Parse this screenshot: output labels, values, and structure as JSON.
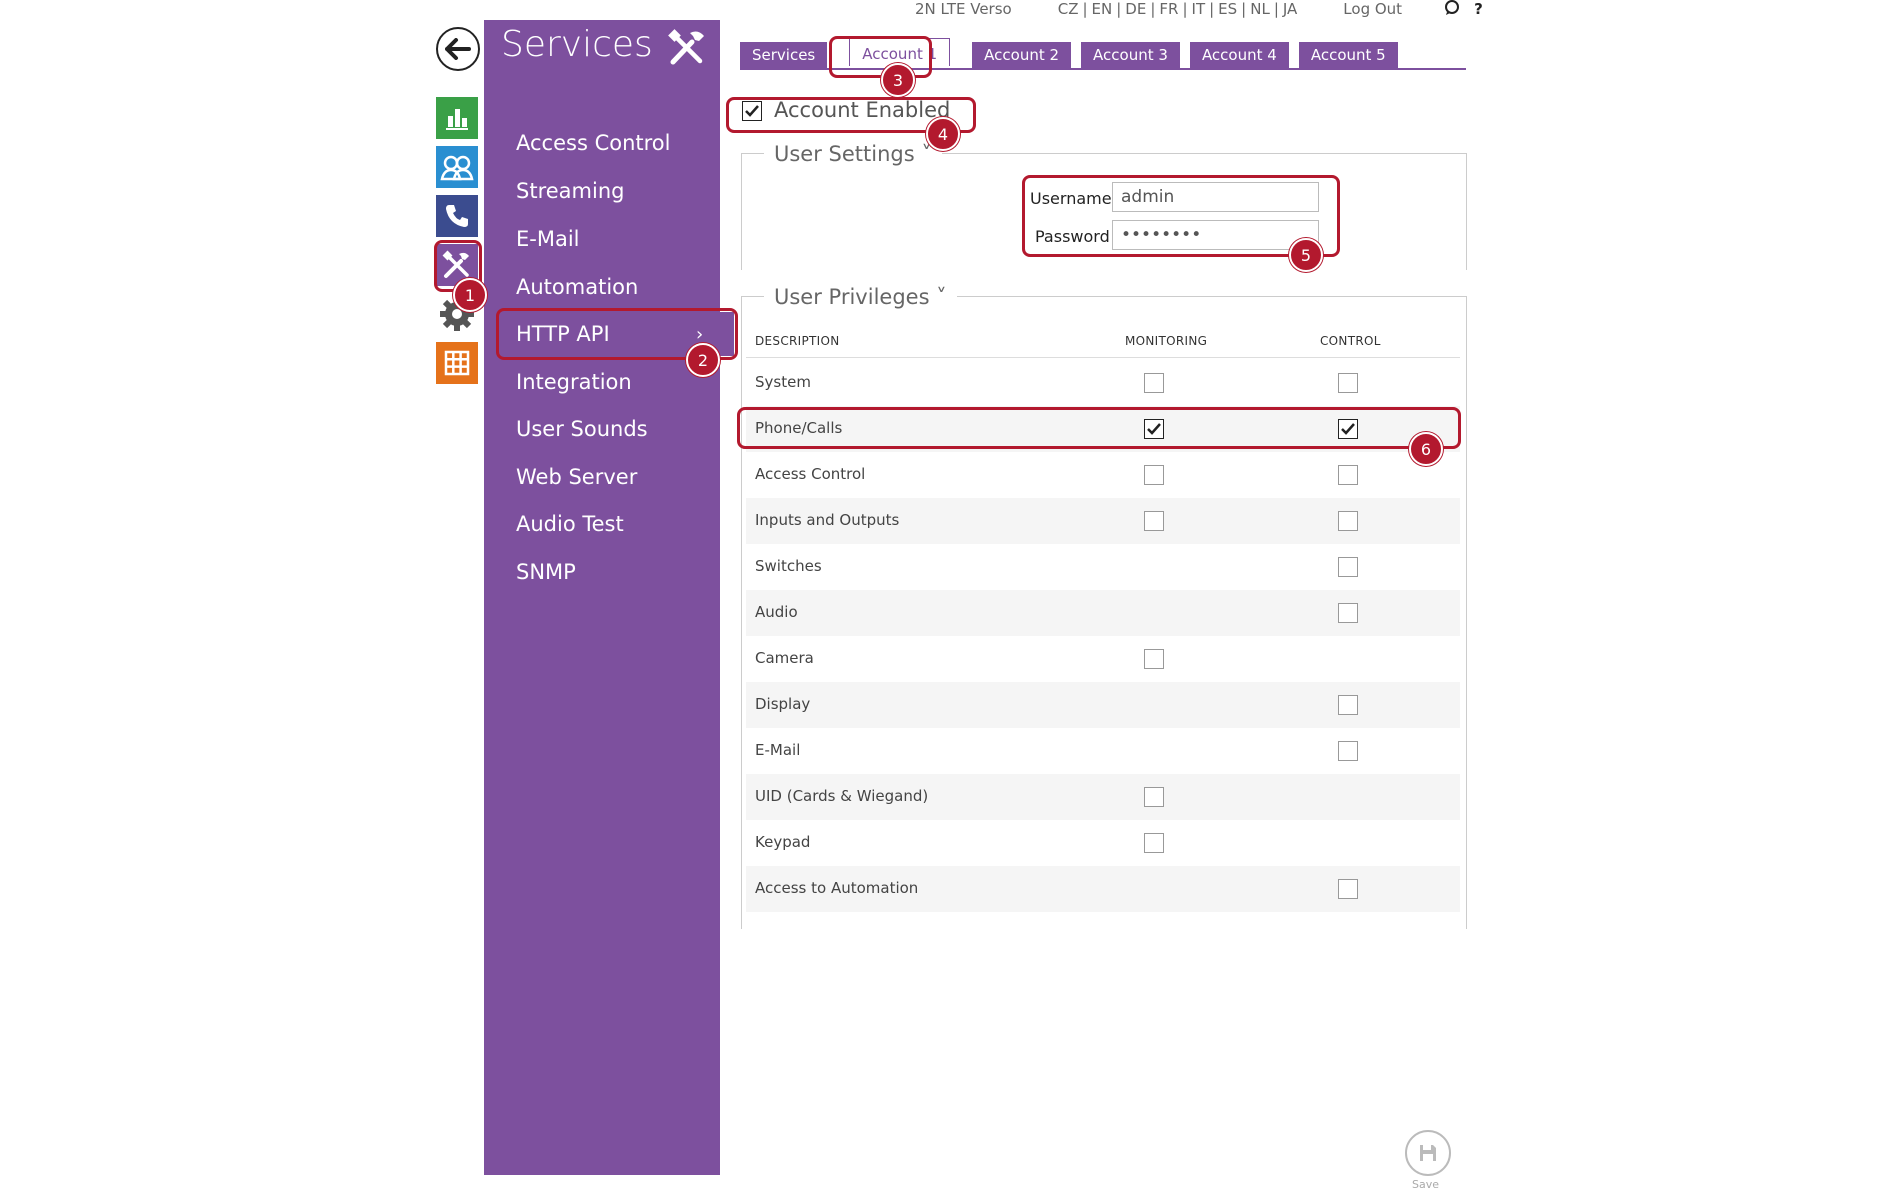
{
  "topbar": {
    "device": "2N LTE Verso",
    "languages": [
      "CZ",
      "EN",
      "DE",
      "FR",
      "IT",
      "ES",
      "NL",
      "JA"
    ],
    "logout": "Log Out",
    "help": "?"
  },
  "rail": {
    "icons": [
      "chart-icon",
      "users-icon",
      "phone-icon",
      "tools-icon",
      "gear-icon",
      "grid-icon"
    ],
    "colors": [
      "#3aa047",
      "#2a8fd1",
      "#3b4c8f",
      "#7d509e",
      "#555555",
      "#e5721a"
    ]
  },
  "sidebar": {
    "title": "Services",
    "items": [
      {
        "label": "Access Control"
      },
      {
        "label": "Streaming"
      },
      {
        "label": "E-Mail"
      },
      {
        "label": "Automation"
      },
      {
        "label": "HTTP API",
        "active": true
      },
      {
        "label": "Integration"
      },
      {
        "label": "User Sounds"
      },
      {
        "label": "Web Server"
      },
      {
        "label": "Audio Test"
      },
      {
        "label": "SNMP"
      }
    ]
  },
  "tabs": [
    "Services",
    "Account 1",
    "Account 2",
    "Account 3",
    "Account 4",
    "Account 5"
  ],
  "active_tab": "Account 1",
  "account": {
    "enabled_label": "Account Enabled",
    "enabled": true
  },
  "user_settings": {
    "title": "User Settings ˅",
    "username_label": "Username",
    "username_value": "admin",
    "password_label": "Password",
    "password_value": "••••••••"
  },
  "privileges": {
    "title": "User Privileges ˅",
    "headers": {
      "description": "DESCRIPTION",
      "monitoring": "MONITORING",
      "control": "CONTROL"
    },
    "rows": [
      {
        "label": "System",
        "monitoring": false,
        "control": false
      },
      {
        "label": "Phone/Calls",
        "monitoring": true,
        "control": true
      },
      {
        "label": "Access Control",
        "monitoring": false,
        "control": false
      },
      {
        "label": "Inputs and Outputs",
        "monitoring": false,
        "control": false
      },
      {
        "label": "Switches",
        "monitoring": null,
        "control": false
      },
      {
        "label": "Audio",
        "monitoring": null,
        "control": false
      },
      {
        "label": "Camera",
        "monitoring": false,
        "control": null
      },
      {
        "label": "Display",
        "monitoring": null,
        "control": false
      },
      {
        "label": "E-Mail",
        "monitoring": null,
        "control": false
      },
      {
        "label": "UID (Cards & Wiegand)",
        "monitoring": false,
        "control": null
      },
      {
        "label": "Keypad",
        "monitoring": false,
        "control": null
      },
      {
        "label": "Access to Automation",
        "monitoring": null,
        "control": false
      }
    ]
  },
  "annotations": [
    "1",
    "2",
    "3",
    "4",
    "5",
    "6"
  ],
  "save_label": "Save",
  "accent_color": "#7d509e",
  "highlight_color": "#b3192e"
}
